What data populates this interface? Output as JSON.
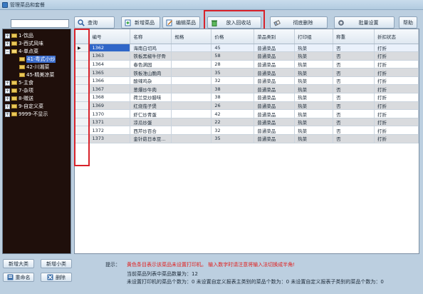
{
  "window": {
    "title": "管理菜品和套餐"
  },
  "search": {
    "value": "",
    "placeholder": ""
  },
  "toolbar": {
    "query_label": "查询",
    "add_dish_label": "新增菜品",
    "edit_dish_label": "编辑菜品",
    "recycle_label": "放入回收站",
    "delete_label": "彻底删除",
    "batch_label": "批量设置",
    "help_label": "帮助"
  },
  "tree": {
    "items": [
      {
        "label": "1-饮品",
        "expander": "+"
      },
      {
        "label": "3-西式风味",
        "expander": "+"
      },
      {
        "label": "4-单点菜",
        "expander": "−"
      },
      {
        "label": "41-粤式小炒"
      },
      {
        "label": "42-川湘菜"
      },
      {
        "label": "45-精美凉菜"
      },
      {
        "label": "5-主食",
        "expander": "+"
      },
      {
        "label": "7-杂项",
        "expander": "+"
      },
      {
        "label": "8-赠送",
        "expander": "+"
      },
      {
        "label": "9-自定义菜",
        "expander": "+"
      },
      {
        "label": "9999-不显示",
        "expander": "+"
      }
    ]
  },
  "table": {
    "headers": [
      "编号",
      "名称",
      "规格",
      "价格",
      "菜品类别",
      "打印组",
      "称重",
      "折扣状态"
    ],
    "rows": [
      [
        "1362",
        "海南白切鸡",
        "",
        "45",
        "普通菜品",
        "热菜",
        "否",
        "打折"
      ],
      [
        "1363",
        "铁板黑椒牛仔骨",
        "",
        "58",
        "普通菜品",
        "热菜",
        "否",
        "打折"
      ],
      [
        "1364",
        "春色满园",
        "",
        "28",
        "普通菜品",
        "热菜",
        "否",
        "打折"
      ],
      [
        "1365",
        "铁板淮山脆肉",
        "",
        "35",
        "普通菜品",
        "热菜",
        "否",
        "打折"
      ],
      [
        "1366",
        "酸辣鸡杂",
        "",
        "32",
        "普通菜品",
        "热菜",
        "否",
        "打折"
      ],
      [
        "1367",
        "葱爆炒牛肉",
        "",
        "38",
        "普通菜品",
        "热菜",
        "否",
        "打折"
      ],
      [
        "1368",
        "荷兰豆炒腊味",
        "",
        "38",
        "普通菜品",
        "热菜",
        "否",
        "打折"
      ],
      [
        "1369",
        "红烧茄子煲",
        "",
        "26",
        "普通菜品",
        "热菜",
        "否",
        "打折"
      ],
      [
        "1370",
        "虾仁炒青蛋",
        "",
        "42",
        "普通菜品",
        "热菜",
        "否",
        "打折"
      ],
      [
        "1371",
        "凉瓜炒蛋",
        "",
        "22",
        "普通菜品",
        "热菜",
        "否",
        "打折"
      ],
      [
        "1372",
        "西芹炒百合",
        "",
        "32",
        "普通菜品",
        "热菜",
        "否",
        "打折"
      ],
      [
        "1373",
        "金针菇日本豆...",
        "",
        "35",
        "普通菜品",
        "热菜",
        "否",
        "打折"
      ]
    ]
  },
  "bottom": {
    "add_category_label": "新增大类",
    "add_subcategory_label": "新增小类",
    "rename_label": "重命名",
    "delete_label": "删除"
  },
  "hints": {
    "label": "提示：",
    "red": "黄色条目表示该菜品未设置打印机。  输入数字时请注意将输入法切换成半角!",
    "line1": "当前菜品列表中菜品数量为：12",
    "line2": "未设置打印机的菜品个数为：0    未设置自定义报表主类别的菜品个数为：0    未设置自定义报表子类别的菜品个数为：0"
  },
  "colors": {
    "highlight": "#d8222a",
    "tree_bg": "#1f0f0b",
    "selected_row": "#2f66c8",
    "hint_red": "#e0201e"
  }
}
